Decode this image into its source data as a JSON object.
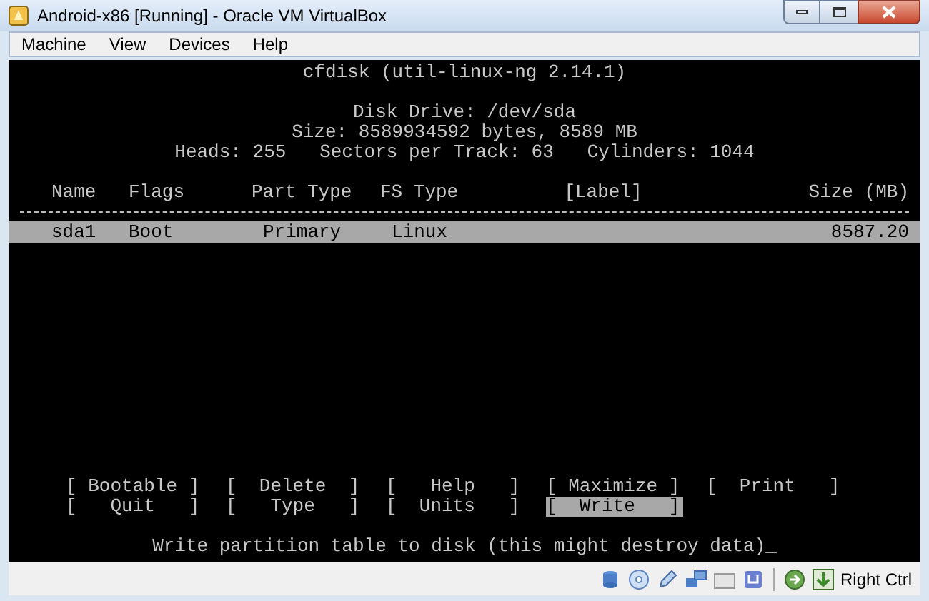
{
  "window": {
    "title": "Android-x86 [Running] - Oracle VM VirtualBox"
  },
  "menu": [
    "Machine",
    "View",
    "Devices",
    "Help"
  ],
  "terminal": {
    "header": "cfdisk (util-linux-ng 2.14.1)",
    "disk_info": [
      "Disk Drive: /dev/sda",
      "Size: 8589934592 bytes, 8589 MB",
      "Heads: 255   Sectors per Track: 63   Cylinders: 1044"
    ],
    "columns": [
      "Name",
      "Flags",
      "Part Type",
      "FS Type",
      "[Label]",
      "Size (MB)"
    ],
    "rows": [
      {
        "cells": [
          "sda1",
          "Boot",
          "Primary",
          "Linux",
          "",
          "8587.20"
        ],
        "selected": true
      }
    ],
    "actions": [
      {
        "label": "[ Bootable ]",
        "selected": false
      },
      {
        "label": "[  Delete  ]",
        "selected": false
      },
      {
        "label": "[   Help   ]",
        "selected": false
      },
      {
        "label": "[ Maximize ]",
        "selected": false
      },
      {
        "label": "[  Print   ]",
        "selected": false
      },
      {
        "label": "[   Quit   ]",
        "selected": false
      },
      {
        "label": "[   Type   ]",
        "selected": false
      },
      {
        "label": "[  Units   ]",
        "selected": false
      },
      {
        "label": "[  Write   ]",
        "selected": true
      }
    ],
    "hint": "Write partition table to disk (this might destroy data)_"
  },
  "status_bar": {
    "host_key": "Right Ctrl"
  }
}
